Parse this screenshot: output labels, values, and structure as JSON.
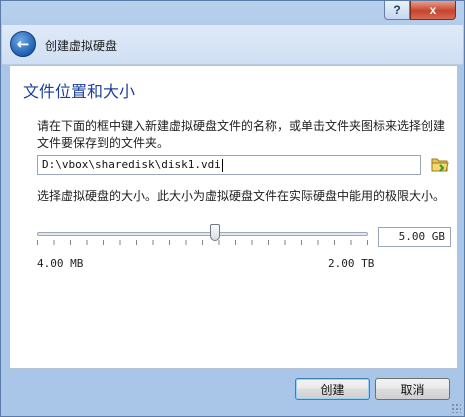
{
  "window": {
    "help_icon": "?",
    "close_icon": "x"
  },
  "header": {
    "title": "创建虚拟硬盘",
    "back_icon": "back-arrow-icon"
  },
  "page": {
    "title": "文件位置和大小",
    "description": "请在下面的框中键入新建虚拟硬盘文件的名称，或单击文件夹图标来选择创建文件要保存到的文件夹。",
    "file_path": "D:\\vbox\\sharedisk\\disk1.vdi",
    "folder_icon": "folder-browse-icon",
    "size_description": "选择虚拟硬盘的大小。此大小为虚拟硬盘文件在实际硬盘中能用的极限大小。",
    "size_value": "5.00 GB",
    "slider_position": 0.54,
    "range_min": "4.00 MB",
    "range_max": "2.00 TB"
  },
  "buttons": {
    "create": "创建",
    "cancel": "取消"
  },
  "colors": {
    "title_blue": "#1e3f9a",
    "frame": "#a9c6e8",
    "close_red": "#c7442c"
  }
}
